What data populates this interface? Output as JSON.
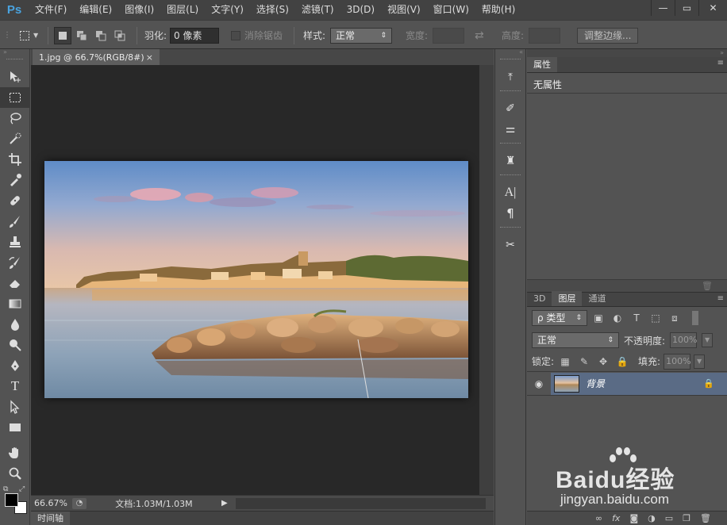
{
  "app": {
    "logo": "Ps"
  },
  "menu": [
    "文件(F)",
    "编辑(E)",
    "图像(I)",
    "图层(L)",
    "文字(Y)",
    "选择(S)",
    "滤镜(T)",
    "3D(D)",
    "视图(V)",
    "窗口(W)",
    "帮助(H)"
  ],
  "window_controls": {
    "minimize": "—",
    "maximize": "▭",
    "close": "✕"
  },
  "options": {
    "feather_label": "羽化:",
    "feather_value": "0 像素",
    "antialias_label": "消除锯齿",
    "style_label": "样式:",
    "style_value": "正常",
    "width_label": "宽度:",
    "swap_icon": "⇄",
    "height_label": "高度:",
    "refine_button": "调整边缘..."
  },
  "document": {
    "tab_title": "1.jpg @ 66.7%(RGB/8#)",
    "tab_close": "×",
    "zoom": "66.67%",
    "doc_info": "文档:1.03M/1.03M",
    "timeline_label": "时间轴"
  },
  "properties": {
    "tab": "属性",
    "empty_text": "无属性"
  },
  "layers": {
    "tabs": [
      "3D",
      "图层",
      "通道"
    ],
    "filter_label": "ρ 类型",
    "blend_mode": "正常",
    "opacity_label": "不透明度:",
    "opacity_value": "100%",
    "lock_label": "锁定:",
    "fill_label": "填充:",
    "fill_value": "100%",
    "layer_name": "背景"
  },
  "watermark": {
    "brand": "Baidu经验",
    "url": "jingyan.baidu.com"
  },
  "colors": {
    "accent": "#4aa3df",
    "panel": "#535353",
    "canvas": "#282828",
    "layer_selected": "#5a6b85"
  }
}
